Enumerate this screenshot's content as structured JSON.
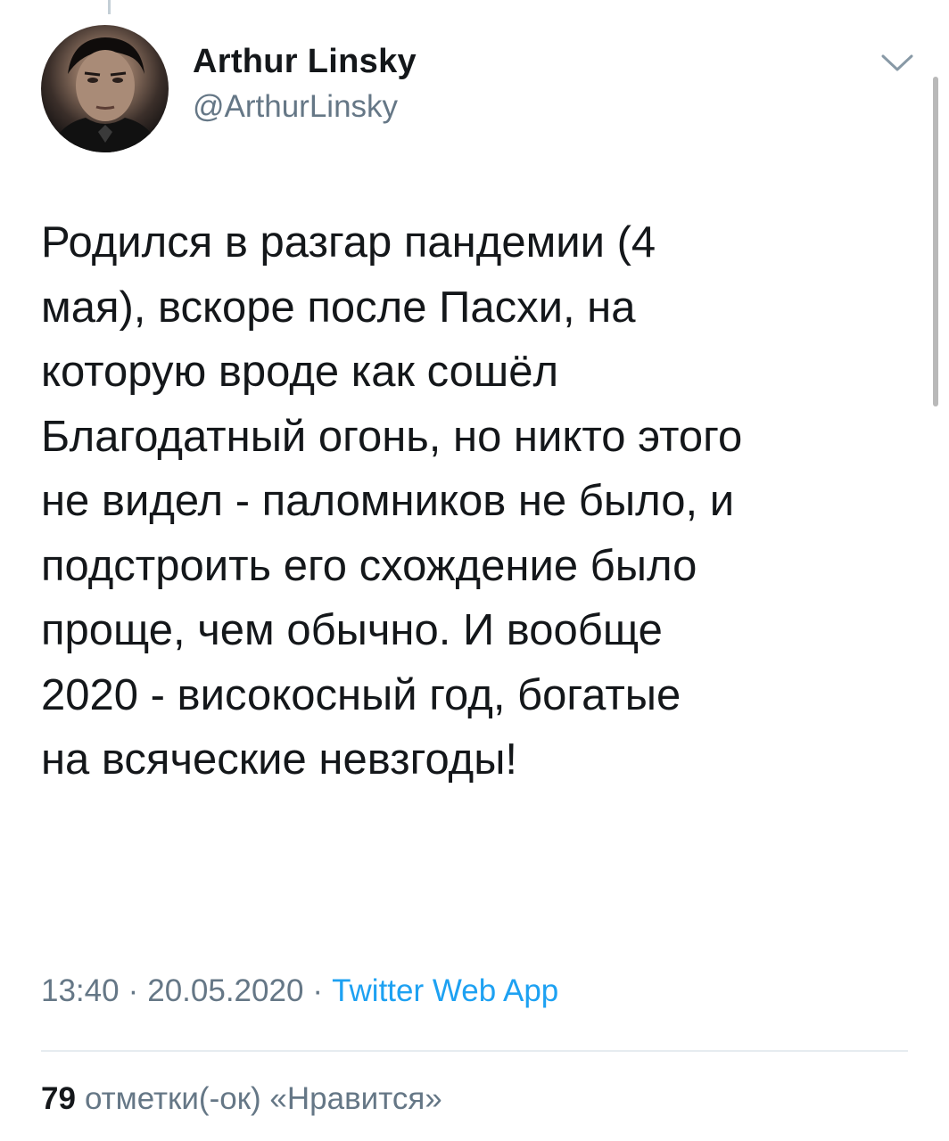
{
  "author": {
    "name": "Arthur Linsky",
    "handle": "@ArthurLinsky"
  },
  "icons": {
    "menu": "chevron-down-icon"
  },
  "tweet": {
    "text": "Родился в разгар пандемии (4\nмая), вскоре после Пасхи, на\nкоторую вроде как сошёл\nБлагодатный огонь, но никто этого\nне видел - паломников не было, и\nподстроить его схождение было\nпроще, чем обычно. И вообще\n2020 - високосный год, богатые\nна всяческие невзгоды!",
    "time": "13:40",
    "separator": "·",
    "date": "20.05.2020",
    "source": "Twitter Web App"
  },
  "stats": {
    "likes_count": "79",
    "likes_label": "отметки(-ок) «Нравится»"
  },
  "colors": {
    "text": "#14171a",
    "secondary": "#657786",
    "link": "#1da1f2",
    "divider": "#e6ecf0"
  }
}
